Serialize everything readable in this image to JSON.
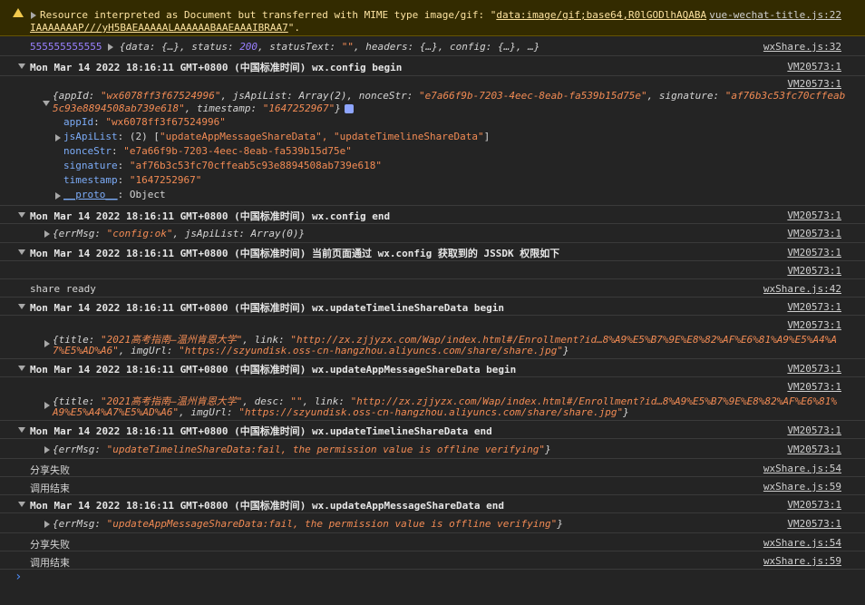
{
  "warning": {
    "text_part1": "Resource interpreted as Document but transferred with MIME type image/gif: \"",
    "link": "data:image/gif;base64,R0lGODlhAQABA",
    "text_part2": "IAAAAAAAP///yH5BAEAAAAALAAAAAABAAEAAAIBRAA7",
    "text_part3": "\".",
    "source": "vue-wechat-title.js:22"
  },
  "log1": {
    "prefix": "555555555555",
    "obj_open": "{data: {…}, status: ",
    "status": "200",
    "obj_mid": ", statusText: ",
    "status_text": "\"\"",
    "obj_close": ", headers: {…}, config: {…}, …}",
    "source": "wxShare.js:32"
  },
  "group1": {
    "title": "Mon Mar 14 2022 18:16:11 GMT+0800 (中国标准时间) wx.config begin",
    "source": "VM20573:1",
    "obj_source": "VM20573:1",
    "obj_line1_a": "{appId: ",
    "obj_line1_appid": "\"wx6078ff3f67524996\"",
    "obj_line1_b": ", jsApiList: Array(2), nonceStr: ",
    "obj_line1_nonce": "\"e7a66f9b-7203-4eec-8eab-fa539b15d75e\"",
    "obj_line1_c": ", signature: ",
    "obj_line1_sig": "\"af76b3c53fc70cffeab",
    "obj_line2_sig": "5c93e8894508ab739e618\"",
    "obj_line2_b": ", timestamp: ",
    "obj_line2_ts": "\"1647252967\"",
    "obj_line2_c": "}",
    "props": [
      {
        "key": "appId",
        "sep": ": ",
        "val": "\"wx6078ff3f67524996\""
      },
      {
        "key": "jsApiList",
        "sep": ": (2) [",
        "val": "\"updateAppMessageShareData\", \"updateTimelineShareData\"",
        "end": "]"
      },
      {
        "key": "nonceStr",
        "sep": ": ",
        "val": "\"e7a66f9b-7203-4eec-8eab-fa539b15d75e\""
      },
      {
        "key": "signature",
        "sep": ": ",
        "val": "\"af76b3c53fc70cffeab5c93e8894508ab739e618\""
      },
      {
        "key": "timestamp",
        "sep": ": ",
        "val": "\"1647252967\""
      },
      {
        "key": "__proto__",
        "sep": ": ",
        "val": "Object"
      }
    ]
  },
  "group2": {
    "title": "Mon Mar 14 2022 18:16:11 GMT+0800 (中国标准时间) wx.config end",
    "source": "VM20573:1",
    "obj_a": "{errMsg: ",
    "obj_val": "\"config:ok\"",
    "obj_b": ", jsApiList: Array(0)}",
    "obj_source": "VM20573:1"
  },
  "group3": {
    "title": "Mon Mar 14 2022 18:16:11 GMT+0800 (中国标准时间) 当前页面通过 wx.config 获取到的 JSSDK 权限如下",
    "source": "VM20573:1",
    "sub_source": "VM20573:1"
  },
  "share_ready": {
    "text": "share ready",
    "source": "wxShare.js:42"
  },
  "group4": {
    "title": "Mon Mar 14 2022 18:16:11 GMT+0800 (中国标准时间) wx.updateTimelineShareData begin",
    "source": "VM20573:1",
    "obj_source": "VM20573:1",
    "l1_a": "{title: ",
    "l1_title": "\"2021高考指南—温州肯恩大学\"",
    "l1_b": ", link: ",
    "l1_link": "\"http://zx.zjjyzx.com/Wap/index.html#/Enrollment?id…8%A9%E5%B7%9E%E8%82%AF%E6%81%A9%E5%A4%A",
    "l2_link": "7%E5%AD%A6\"",
    "l2_b": ", imgUrl: ",
    "l2_img": "\"https://szyundisk.oss-cn-hangzhou.aliyuncs.com/share/share.jpg\"",
    "l2_c": "}"
  },
  "group5": {
    "title": "Mon Mar 14 2022 18:16:11 GMT+0800 (中国标准时间) wx.updateAppMessageShareData begin",
    "source": "VM20573:1",
    "obj_source": "VM20573:1",
    "l1_a": "{title: ",
    "l1_title": "\"2021高考指南—温州肯恩大学\"",
    "l1_b": ", desc: ",
    "l1_desc": "\"\"",
    "l1_c": ", link: ",
    "l1_link": "\"http://zx.zjjyzx.com/Wap/index.html#/Enrollment?id…8%A9%E5%B7%9E%E8%82%AF%E6%81%",
    "l2_link": "A9%E5%A4%A7%E5%AD%A6\"",
    "l2_b": ", imgUrl: ",
    "l2_img": "\"https://szyundisk.oss-cn-hangzhou.aliyuncs.com/share/share.jpg\"",
    "l2_c": "}"
  },
  "group6": {
    "title": "Mon Mar 14 2022 18:16:11 GMT+0800 (中国标准时间) wx.updateTimelineShareData end",
    "source": "VM20573:1",
    "obj_a": "{errMsg: ",
    "obj_val": "\"updateTimelineShareData:fail, the permission value is offline verifying\"",
    "obj_b": "}",
    "obj_source": "VM20573:1"
  },
  "fail1": {
    "text": "分享失败",
    "source": "wxShare.js:54"
  },
  "end1": {
    "text": "调用结束",
    "source": "wxShare.js:59"
  },
  "group7": {
    "title": "Mon Mar 14 2022 18:16:11 GMT+0800 (中国标准时间) wx.updateAppMessageShareData end",
    "source": "VM20573:1",
    "obj_a": "{errMsg: ",
    "obj_val": "\"updateAppMessageShareData:fail, the permission value is offline verifying\"",
    "obj_b": "}",
    "obj_source": "VM20573:1"
  },
  "fail2": {
    "text": "分享失败",
    "source": "wxShare.js:54"
  },
  "end2": {
    "text": "调用结束",
    "source": "wxShare.js:59"
  },
  "prompt": {
    "symbol": "›"
  },
  "colors": {
    "background": "#242424",
    "warning_bg": "#332b00",
    "string": "#f28b54",
    "number": "#9980ff",
    "key": "#7cacf8"
  }
}
